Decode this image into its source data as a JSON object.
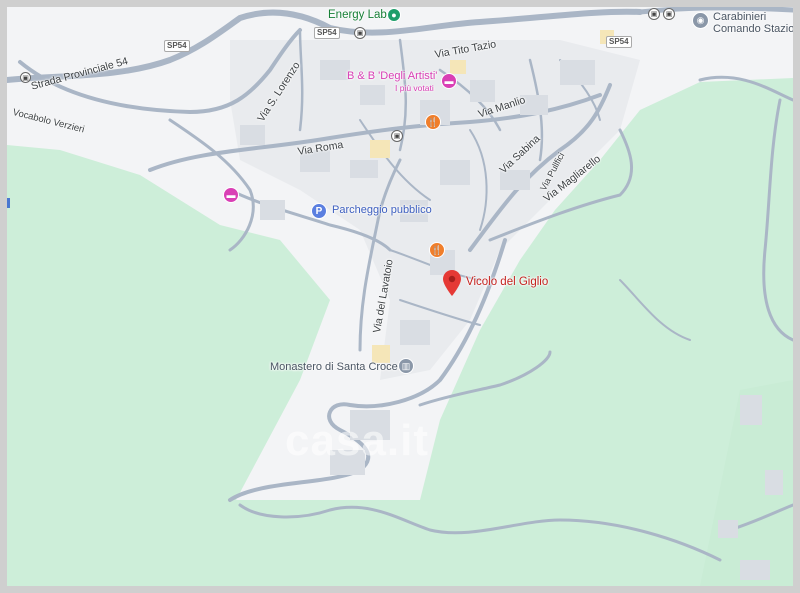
{
  "places": {
    "energy_lab": "Energy Lab",
    "bb_artisti": "B & B 'Degli Artisti'",
    "bb_sub": "I più votati",
    "carabinieri_l1": "Carabinieri",
    "carabinieri_l2": "Comando Stazio",
    "parcheggio": "Parcheggio pubblico",
    "vicolo": "Vicolo del Giglio",
    "monastero": "Monastero di Santa Croce"
  },
  "streets": {
    "strada_prov": "Strada Provinciale 54",
    "vocabolo": "Vocabolo Verzieri",
    "s_lorenzo": "Via S. Lorenzo",
    "tito_tazio": "Via Tito Tazio",
    "manlio": "Via Manlio",
    "roma": "Via Roma",
    "sabina": "Via Sabina",
    "pullfici": "Via Pullfici",
    "magliarello": "Via Magliarello",
    "lavatoio": "Via del Lavatoio"
  },
  "shields": {
    "sp54_a": "SP54",
    "sp54_b": "SP54",
    "sp54_c": "SP54"
  },
  "watermark": "casa.it",
  "colors": {
    "green": "#cdeed9",
    "urban": "#f3f4f6",
    "road": "#aab6c6",
    "poi_pink": "#d93fb5",
    "poi_orange": "#f07e2b",
    "pin_red": "#e53935"
  }
}
